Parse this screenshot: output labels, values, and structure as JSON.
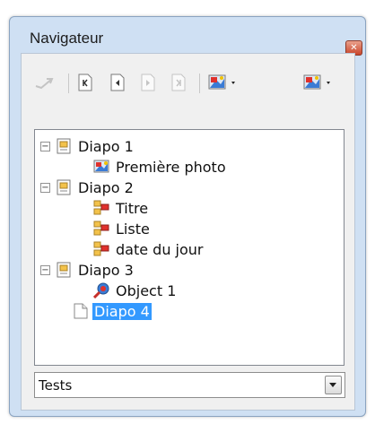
{
  "window": {
    "title": "Navigateur",
    "close_icon": "close-icon"
  },
  "toolbar": {
    "buttons": [
      {
        "name": "drag-mode-icon",
        "enabled": false
      },
      {
        "name": "first-slide-icon",
        "enabled": true
      },
      {
        "name": "previous-slide-icon",
        "enabled": true
      },
      {
        "name": "next-slide-icon",
        "enabled": false
      },
      {
        "name": "last-slide-icon",
        "enabled": false
      },
      {
        "name": "drag-mode-dropdown-icon",
        "enabled": true
      },
      {
        "name": "show-shapes-dropdown-icon",
        "enabled": true
      }
    ]
  },
  "tree": {
    "items": [
      {
        "label": "Diapo 1",
        "kind": "slide",
        "expanded": true
      },
      {
        "label": "Première photo",
        "kind": "image"
      },
      {
        "label": "Diapo 2",
        "kind": "slide",
        "expanded": true
      },
      {
        "label": "Titre",
        "kind": "shape"
      },
      {
        "label": "Liste",
        "kind": "shape"
      },
      {
        "label": "date du jour",
        "kind": "shape"
      },
      {
        "label": "Diapo 3",
        "kind": "slide",
        "expanded": true
      },
      {
        "label": "Object 1",
        "kind": "object"
      },
      {
        "label": "Diapo 4",
        "kind": "slide-empty",
        "selected": true
      }
    ]
  },
  "document_select": {
    "value": "Tests"
  },
  "colors": {
    "selection": "#3399ff",
    "frame": "#cfe0f3",
    "close": "#c9452a"
  }
}
